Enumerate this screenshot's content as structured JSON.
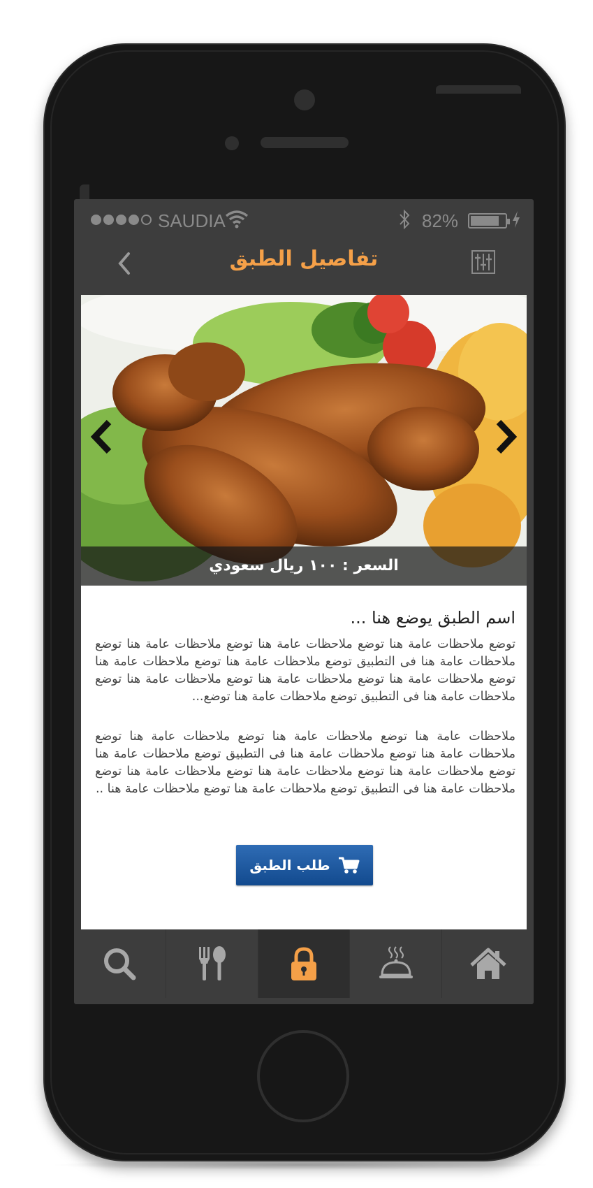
{
  "status_bar": {
    "carrier": "SAUDIA",
    "battery_percent": "82%",
    "signal_bars_filled": 4,
    "signal_bars_total": 5
  },
  "nav": {
    "title": "تفاصيل الطبق",
    "back_icon": "chevron-left-icon",
    "filter_icon": "sliders-icon"
  },
  "gallery": {
    "price_label": "السعر : ١٠٠ ريال سعودي",
    "prev_icon": "chevron-left-icon",
    "next_icon": "chevron-right-icon"
  },
  "dish": {
    "name": "اسم الطبق يوضع هنا ...",
    "description_1": "توضع ملاحظات عامة هنا توضع ملاحظات عامة هنا توضع ملاحظات عامة هنا توضع ملاحظات عامة هنا فى التطبيق  توضع ملاحظات عامة هنا توضع ملاحظات عامة هنا توضع ملاحظات عامة هنا توضع ملاحظات عامة هنا توضع ملاحظات عامة هنا توضع ملاحظات عامة هنا فى التطبيق  توضع ملاحظات عامة هنا توضع...",
    "description_2": "ملاحظات عامة هنا توضع ملاحظات عامة هنا توضع ملاحظات عامة هنا توضع ملاحظات عامة هنا توضع ملاحظات عامة هنا فى التطبيق  توضع ملاحظات عامة هنا توضع ملاحظات عامة هنا توضع ملاحظات عامة هنا توضع ملاحظات عامة هنا توضع ملاحظات عامة هنا فى التطبيق  توضع ملاحظات عامة هنا توضع ملاحظات عامة هنا .."
  },
  "order_button": {
    "label": "طلب الطبق",
    "icon": "cart-icon"
  },
  "tabs": [
    {
      "icon": "search-icon",
      "active": false
    },
    {
      "icon": "fork-spoon-icon",
      "active": false
    },
    {
      "icon": "lock-icon",
      "active": true
    },
    {
      "icon": "serving-dish-icon",
      "active": false
    },
    {
      "icon": "home-icon",
      "active": false
    }
  ],
  "colors": {
    "accent": "#f5a048",
    "button_blue": "#1b5aa3",
    "screen_bg": "#3d3d3d",
    "phone_body": "#171717"
  }
}
